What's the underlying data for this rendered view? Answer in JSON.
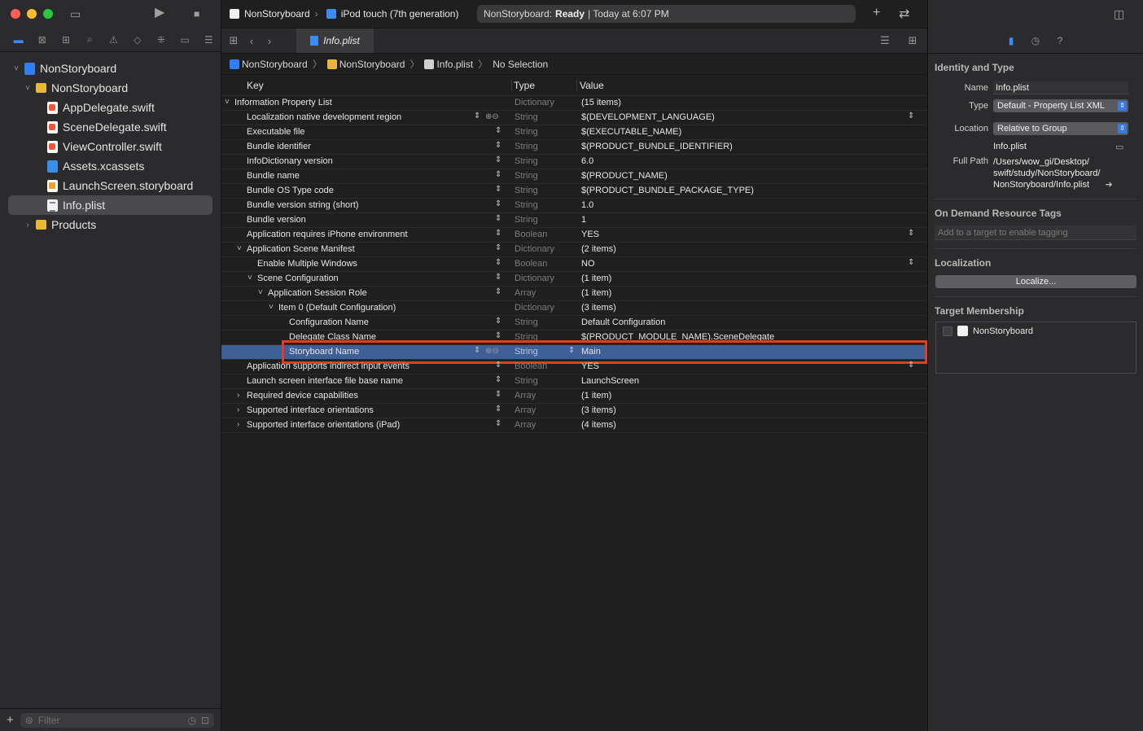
{
  "navigator": {
    "items": [
      {
        "label": "NonStoryboard",
        "icon": "project-icon",
        "indent": 0,
        "disclosure": "˅"
      },
      {
        "label": "NonStoryboard",
        "icon": "folder-icon",
        "indent": 1,
        "disclosure": "˅"
      },
      {
        "label": "AppDelegate.swift",
        "icon": "swift-file-icon",
        "indent": 2,
        "disclosure": ""
      },
      {
        "label": "SceneDelegate.swift",
        "icon": "swift-file-icon",
        "indent": 2,
        "disclosure": ""
      },
      {
        "label": "ViewController.swift",
        "icon": "swift-file-icon",
        "indent": 2,
        "disclosure": ""
      },
      {
        "label": "Assets.xcassets",
        "icon": "assets-icon",
        "indent": 2,
        "disclosure": ""
      },
      {
        "label": "LaunchScreen.storyboard",
        "icon": "storyboard-icon",
        "indent": 2,
        "disclosure": ""
      },
      {
        "label": "Info.plist",
        "icon": "plist-icon",
        "indent": 2,
        "disclosure": "",
        "selected": true
      },
      {
        "label": "Products",
        "icon": "folder-icon",
        "indent": 1,
        "disclosure": "›"
      }
    ],
    "filter_placeholder": "Filter"
  },
  "toolbar": {
    "scheme": "NonStoryboard",
    "device": "iPod touch (7th generation)",
    "status_prefix": "NonStoryboard:",
    "status_state": "Ready",
    "status_time": "| Today at 6:07 PM"
  },
  "tab": {
    "label": "Info.plist"
  },
  "jumpbar": {
    "project": "NonStoryboard",
    "folder": "NonStoryboard",
    "file": "Info.plist",
    "selection": "No Selection"
  },
  "plist": {
    "headers": {
      "key": "Key",
      "type": "Type",
      "value": "Value"
    },
    "rows": [
      {
        "key": "Information Property List",
        "type": "Dictionary",
        "value": "(15 items)",
        "level": 0,
        "chev": "˅",
        "stepper": false,
        "drop": false
      },
      {
        "key": "Localization native development region",
        "type": "String",
        "value": "$(DEVELOPMENT_LANGUAGE)",
        "level": 1,
        "chev": "",
        "stepper": true,
        "addrm": true,
        "drop": true
      },
      {
        "key": "Executable file",
        "type": "String",
        "value": "$(EXECUTABLE_NAME)",
        "level": 1,
        "chev": "",
        "stepper": true,
        "drop": false
      },
      {
        "key": "Bundle identifier",
        "type": "String",
        "value": "$(PRODUCT_BUNDLE_IDENTIFIER)",
        "level": 1,
        "chev": "",
        "stepper": true,
        "drop": false
      },
      {
        "key": "InfoDictionary version",
        "type": "String",
        "value": "6.0",
        "level": 1,
        "chev": "",
        "stepper": true,
        "drop": false
      },
      {
        "key": "Bundle name",
        "type": "String",
        "value": "$(PRODUCT_NAME)",
        "level": 1,
        "chev": "",
        "stepper": true,
        "drop": false
      },
      {
        "key": "Bundle OS Type code",
        "type": "String",
        "value": "$(PRODUCT_BUNDLE_PACKAGE_TYPE)",
        "level": 1,
        "chev": "",
        "stepper": true,
        "drop": false
      },
      {
        "key": "Bundle version string (short)",
        "type": "String",
        "value": "1.0",
        "level": 1,
        "chev": "",
        "stepper": true,
        "drop": false
      },
      {
        "key": "Bundle version",
        "type": "String",
        "value": "1",
        "level": 1,
        "chev": "",
        "stepper": true,
        "drop": false
      },
      {
        "key": "Application requires iPhone environment",
        "type": "Boolean",
        "value": "YES",
        "level": 1,
        "chev": "",
        "stepper": true,
        "drop": true
      },
      {
        "key": "Application Scene Manifest",
        "type": "Dictionary",
        "value": "(2 items)",
        "level": 1,
        "chev": "˅",
        "stepper": true,
        "drop": false
      },
      {
        "key": "Enable Multiple Windows",
        "type": "Boolean",
        "value": "NO",
        "level": 2,
        "chev": "",
        "stepper": true,
        "drop": true
      },
      {
        "key": "Scene Configuration",
        "type": "Dictionary",
        "value": "(1 item)",
        "level": 2,
        "chev": "˅",
        "stepper": true,
        "drop": false
      },
      {
        "key": "Application Session Role",
        "type": "Array",
        "value": "(1 item)",
        "level": 3,
        "chev": "˅",
        "stepper": true,
        "drop": false
      },
      {
        "key": "Item 0 (Default Configuration)",
        "type": "Dictionary",
        "value": "(3 items)",
        "level": 4,
        "chev": "˅",
        "stepper": false,
        "drop": false
      },
      {
        "key": "Configuration Name",
        "type": "String",
        "value": "Default Configuration",
        "level": 5,
        "chev": "",
        "stepper": true,
        "drop": false
      },
      {
        "key": "Delegate Class Name",
        "type": "String",
        "value": "$(PRODUCT_MODULE_NAME).SceneDelegate",
        "level": 5,
        "chev": "",
        "stepper": true,
        "drop": false
      },
      {
        "key": "Storyboard Name",
        "type": "String",
        "value": "Main",
        "level": 5,
        "chev": "",
        "stepper": true,
        "addrm": true,
        "drop": false,
        "selected": true
      },
      {
        "key": "Application supports indirect input events",
        "type": "Boolean",
        "value": "YES",
        "level": 1,
        "chev": "",
        "stepper": true,
        "drop": true
      },
      {
        "key": "Launch screen interface file base name",
        "type": "String",
        "value": "LaunchScreen",
        "level": 1,
        "chev": "",
        "stepper": true,
        "drop": false
      },
      {
        "key": "Required device capabilities",
        "type": "Array",
        "value": "(1 item)",
        "level": 1,
        "chev": "›",
        "stepper": true,
        "drop": false
      },
      {
        "key": "Supported interface orientations",
        "type": "Array",
        "value": "(3 items)",
        "level": 1,
        "chev": "›",
        "stepper": true,
        "drop": false
      },
      {
        "key": "Supported interface orientations (iPad)",
        "type": "Array",
        "value": "(4 items)",
        "level": 1,
        "chev": "›",
        "stepper": true,
        "drop": false
      }
    ]
  },
  "inspector": {
    "identity_title": "Identity and Type",
    "name_label": "Name",
    "name_value": "Info.plist",
    "type_label": "Type",
    "type_value": "Default - Property List XML",
    "location_label": "Location",
    "location_value": "Relative to Group",
    "location_file": "Info.plist",
    "fullpath_label": "Full Path",
    "fullpath_lines": [
      "/Users/wow_gi/Desktop/",
      "swift/study/NonStoryboard/",
      "NonStoryboard/Info.plist"
    ],
    "odr_title": "On Demand Resource Tags",
    "odr_placeholder": "Add to a target to enable tagging",
    "localization_title": "Localization",
    "localize_button": "Localize...",
    "membership_title": "Target Membership",
    "membership_target": "NonStoryboard"
  },
  "colors": {
    "selection_blue": "#3e5f98",
    "highlight_red": "#e23b2c",
    "accent_blue": "#3b8cf5"
  }
}
